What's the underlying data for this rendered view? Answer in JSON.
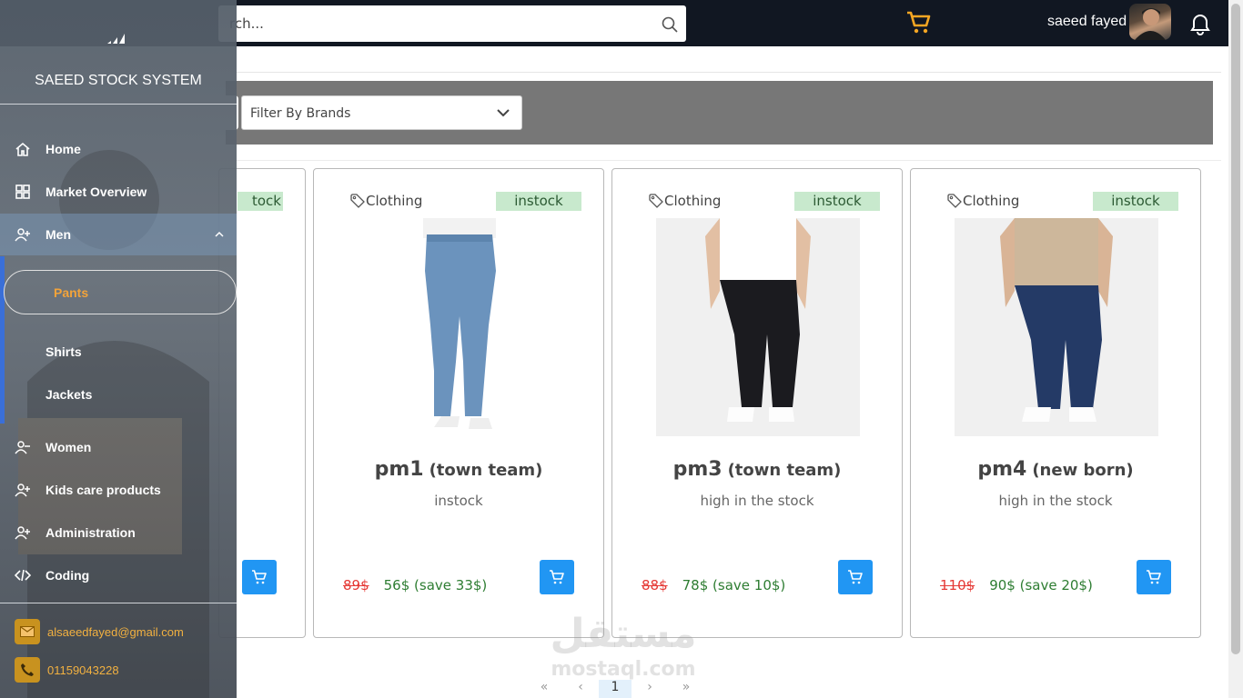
{
  "app": {
    "title": "SAEED STOCK SYSTEM"
  },
  "search": {
    "placeholder": "rch..."
  },
  "user": {
    "name": "saeed fayed"
  },
  "filters": {
    "brands_placeholder": "Filter By Brands"
  },
  "sidebar": {
    "items": [
      {
        "label": "Home",
        "icon": "home-icon"
      },
      {
        "label": "Market Overview",
        "icon": "grid-icon"
      },
      {
        "label": "Men",
        "icon": "user-plus-icon"
      },
      {
        "label": "Women",
        "icon": "user-minus-icon"
      },
      {
        "label": "Kids care products",
        "icon": "user-plus-icon"
      },
      {
        "label": "Administration",
        "icon": "user-plus-icon"
      },
      {
        "label": "Coding",
        "icon": "code-icon"
      }
    ],
    "men_submenu": [
      "Pants",
      "Shirts",
      "Jackets"
    ],
    "contact": {
      "email": "alsaeedfayed@gmail.com",
      "phone": "01159043228"
    }
  },
  "products": [
    {
      "category": "",
      "badge": "tock"
    },
    {
      "category": "Clothing",
      "badge": "instock",
      "name": "pm1",
      "brand": "(town team)",
      "stock": "instock",
      "old_price": "89$",
      "new_price": "56$ (save 33$)"
    },
    {
      "category": "Clothing",
      "badge": "instock",
      "name": "pm3",
      "brand": "(town team)",
      "stock": "high in the stock",
      "old_price": "88$",
      "new_price": "78$ (save 10$)"
    },
    {
      "category": "Clothing",
      "badge": "instock",
      "name": "pm4",
      "brand": "(new born)",
      "stock": "high in the stock",
      "old_price": "110$",
      "new_price": "90$ (save 20$)"
    }
  ],
  "pagination": {
    "first": "«",
    "prev": "‹",
    "current": "1",
    "next": "›",
    "last": "»"
  },
  "watermark": {
    "arabic": "مستقل",
    "latin": "mostaql.com"
  },
  "colors": {
    "topbar": "#111722",
    "accent_orange": "#f5a623",
    "cart_button": "#2196f3",
    "badge_bg": "#c8e9cd",
    "old_price": "#e53935",
    "new_price": "#2e7d32"
  }
}
